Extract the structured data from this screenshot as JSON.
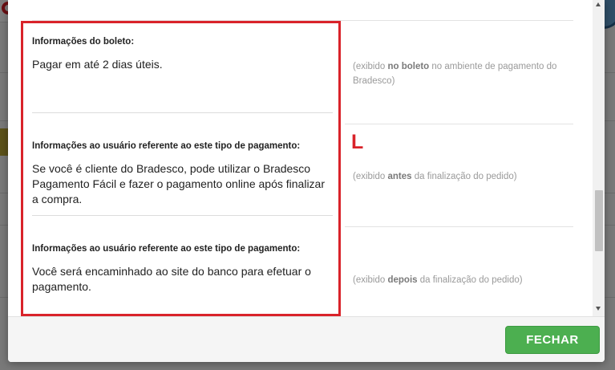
{
  "modal": {
    "sections": [
      {
        "label": "Informações do boleto:",
        "text": "Pagar em até 2 dias úteis.",
        "hint_pre": "(exibido ",
        "hint_bold": "no boleto",
        "hint_post": " no ambiente de pagamento do Bradesco)"
      },
      {
        "label": "Informações ao usuário referente ao este tipo de pagamento:",
        "text": "Se você é cliente do Bradesco, pode utilizar o Bradesco Pagamento Fácil e fazer o pagamento online após finalizar a compra.",
        "hint_pre": "(exibido ",
        "hint_bold": "antes",
        "hint_post": " da finalização do pedido)"
      },
      {
        "label": "Informações ao usuário referente ao este tipo de pagamento:",
        "text": "Você será encaminhado ao site do banco para efetuar o pagamento.",
        "hint_pre": "(exibido ",
        "hint_bold": "depois",
        "hint_post": " da finalização do pedido)"
      }
    ],
    "annotation": "L",
    "close_label": "FECHAR"
  },
  "colors": {
    "accent": "#4caf50",
    "highlight": "#d9232a",
    "hint_text": "#9a9a9a"
  },
  "icons": [
    "scroll-up-arrow-icon",
    "scroll-down-arrow-icon"
  ]
}
